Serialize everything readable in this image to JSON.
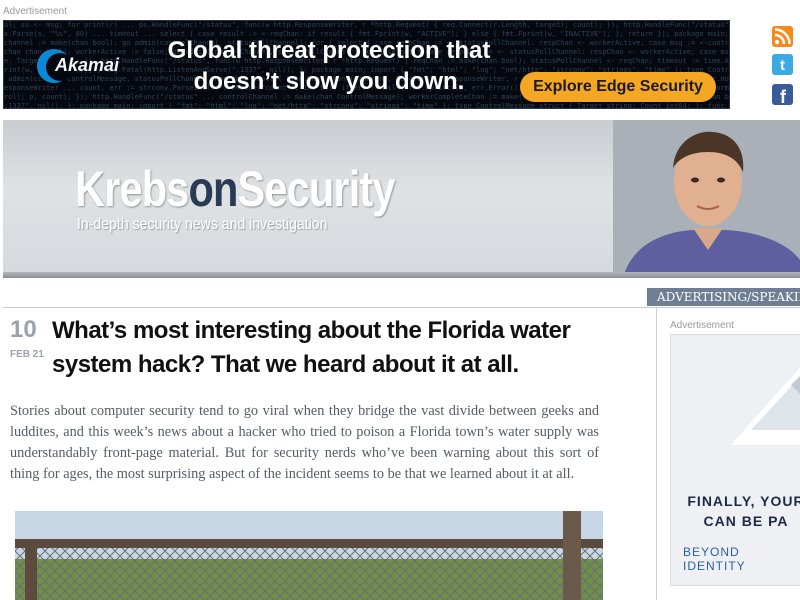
{
  "top_ad": {
    "label": "Advertisement",
    "brand": "Akamai",
    "headline": "Global threat protection that doesn’t slow you down.",
    "cta": "Explore Edge Security"
  },
  "social": {
    "icons": [
      "rss-icon",
      "twitter-icon",
      "facebook-icon"
    ]
  },
  "masthead": {
    "title_part1": "Krebs",
    "title_part2": "on",
    "title_part3": "Security",
    "tagline": "In-depth security news and investigation"
  },
  "nav": {
    "tab_label": "ADVERTISING/SPEAKING"
  },
  "article": {
    "date_day": "10",
    "date_month": "FEB 21",
    "title": "What’s most interesting about the Florida water system hack? That we heard about it at all.",
    "body": "Stories about computer security tend to go viral when they bridge the vast divide between geeks and luddites, and this week’s news about a hacker who tried to poison a Florida town’s water supply was understandably front-page material. But for security nerds who’ve been warning about this sort of thing for ages, the most surprising aspect of the incident seems to be that we learned about it at all."
  },
  "sidebar": {
    "ad_label": "Advertisement",
    "ad_text_line1": "FINALLY, YOUR",
    "ad_text_line2": "CAN BE PA",
    "ad_brand_line1": "BEYOND",
    "ad_brand_line2": "IDENTITY"
  },
  "colors": {
    "accent_nav": "#6e7f93",
    "cta_orange": "#f5a623",
    "akamai_blue": "#0a8ad6",
    "date_gray": "#9aa3ad"
  }
}
